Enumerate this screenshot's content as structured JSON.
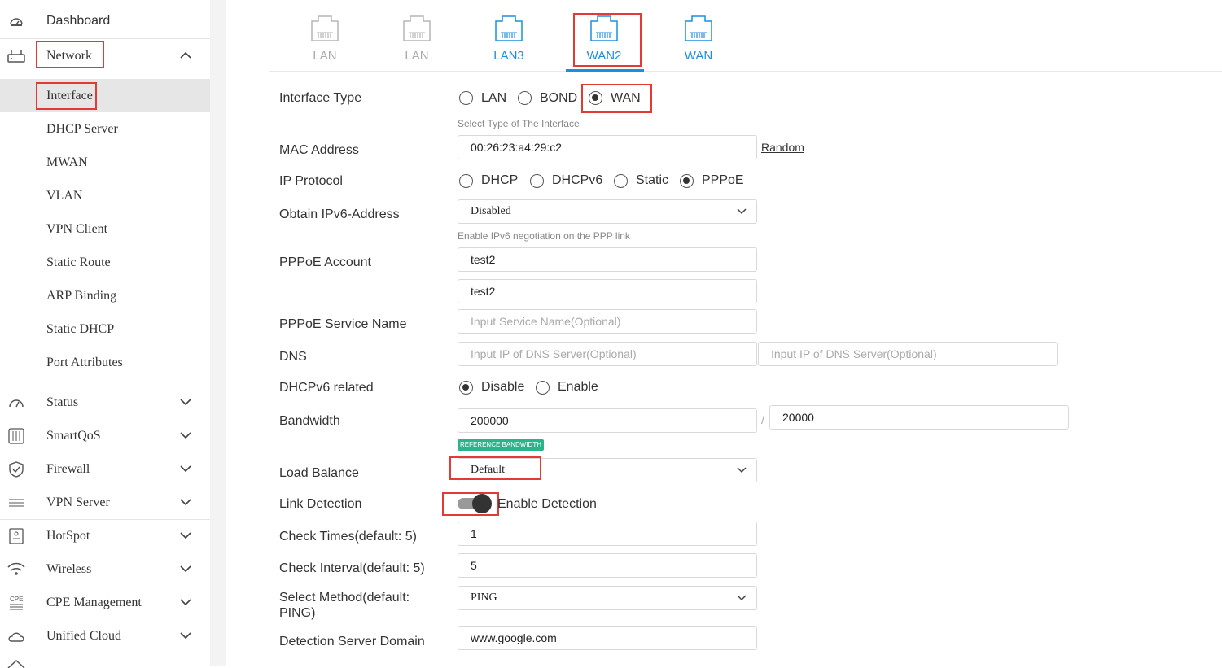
{
  "sidebar": {
    "dashboard": "Dashboard",
    "network": "Network",
    "network_items": [
      "Interface",
      "DHCP Server",
      "MWAN",
      "VLAN",
      "VPN Client",
      "Static Route",
      "ARP Binding",
      "Static DHCP",
      "Port Attributes"
    ],
    "sections": [
      "Status",
      "SmartQoS",
      "Firewall",
      "VPN Server",
      "HotSpot",
      "Wireless",
      "CPE Management",
      "Unified Cloud"
    ]
  },
  "ports": [
    {
      "label": "LAN",
      "state": "inactive"
    },
    {
      "label": "LAN",
      "state": "inactive"
    },
    {
      "label": "LAN3",
      "state": "available"
    },
    {
      "label": "WAN2",
      "state": "selected"
    },
    {
      "label": "WAN",
      "state": "available"
    }
  ],
  "form": {
    "interface_type": {
      "label": "Interface Type",
      "options": [
        "LAN",
        "BOND",
        "WAN"
      ],
      "selected": "WAN",
      "hint": "Select Type of The Interface"
    },
    "mac": {
      "label": "MAC Address",
      "value": "00:26:23:a4:29:c2",
      "random": "Random"
    },
    "ip_protocol": {
      "label": "IP Protocol",
      "options": [
        "DHCP",
        "DHCPv6",
        "Static",
        "PPPoE"
      ],
      "selected": "PPPoE"
    },
    "ipv6": {
      "label": "Obtain IPv6-Address",
      "value": "Disabled",
      "hint": "Enable IPv6 negotiation on the PPP link"
    },
    "pppoe_account": {
      "label": "PPPoE Account",
      "username": "test2",
      "password": "test2"
    },
    "service_name": {
      "label": "PPPoE Service Name",
      "placeholder": "Input Service Name(Optional)"
    },
    "dns": {
      "label": "DNS",
      "placeholder1": "Input IP of DNS Server(Optional)",
      "placeholder2": "Input IP of DNS Server(Optional)"
    },
    "dhcpv6": {
      "label": "DHCPv6 related",
      "options": [
        "Disable",
        "Enable"
      ],
      "selected": "Disable"
    },
    "bandwidth": {
      "label": "Bandwidth",
      "up": "200000",
      "sep": "/",
      "down": "20000",
      "badge": "REFERENCE BANDWIDTH"
    },
    "load_balance": {
      "label": "Load Balance",
      "value": "Default"
    },
    "link_detection": {
      "label": "Link Detection",
      "toggle_label": "Enable Detection",
      "enabled": true
    },
    "check_times": {
      "label": "Check Times(default: 5)",
      "value": "1"
    },
    "check_interval": {
      "label": "Check Interval(default: 5)",
      "value": "5"
    },
    "select_method": {
      "label_line1": "Select Method(default:",
      "label_line2": "PING)",
      "value": "PING"
    },
    "detection_domain": {
      "label": "Detection Server Domain",
      "value": "www.google.com"
    }
  },
  "colors": {
    "accent": "#1a8fe0",
    "highlight": "#e53935",
    "badge": "#2bb38a"
  }
}
